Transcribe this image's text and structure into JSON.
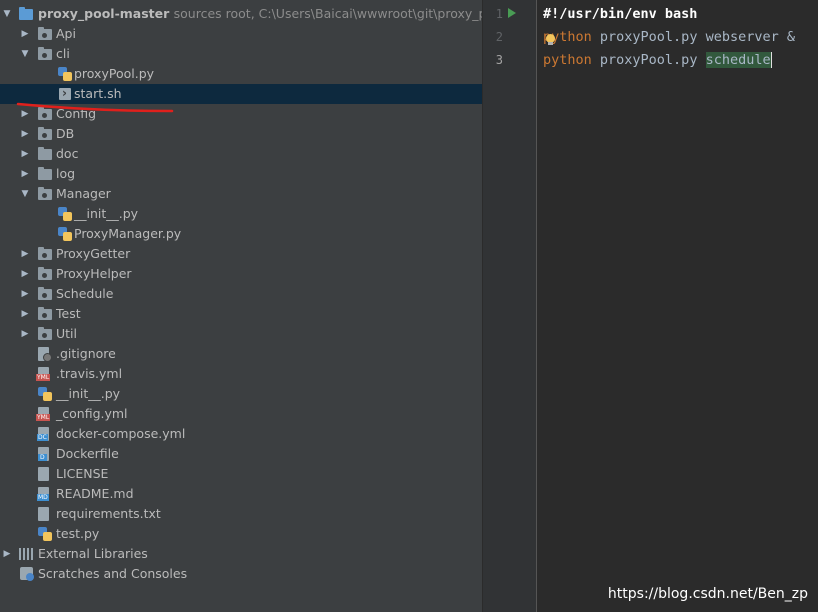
{
  "project_tree": {
    "root": {
      "name": "proxy_pool-master",
      "hint": "sources root,  C:\\Users\\Baicai\\wwwroot\\git\\proxy_pool-"
    },
    "items": [
      {
        "label": "Api",
        "type": "package",
        "expanded": false
      },
      {
        "label": "cli",
        "type": "package",
        "expanded": true
      },
      {
        "label": "proxyPool.py",
        "type": "python"
      },
      {
        "label": "start.sh",
        "type": "shell",
        "selected": true
      },
      {
        "label": "Config",
        "type": "package",
        "expanded": false
      },
      {
        "label": "DB",
        "type": "package",
        "expanded": false
      },
      {
        "label": "doc",
        "type": "folder",
        "expanded": false
      },
      {
        "label": "log",
        "type": "folder",
        "expanded": false
      },
      {
        "label": "Manager",
        "type": "package",
        "expanded": true
      },
      {
        "label": "__init__.py",
        "type": "python"
      },
      {
        "label": "ProxyManager.py",
        "type": "python"
      },
      {
        "label": "ProxyGetter",
        "type": "package",
        "expanded": false
      },
      {
        "label": "ProxyHelper",
        "type": "package",
        "expanded": false
      },
      {
        "label": "Schedule",
        "type": "package",
        "expanded": false
      },
      {
        "label": "Test",
        "type": "package",
        "expanded": false
      },
      {
        "label": "Util",
        "type": "package",
        "expanded": false
      },
      {
        "label": ".gitignore",
        "type": "gitignore"
      },
      {
        "label": ".travis.yml",
        "type": "yml"
      },
      {
        "label": "__init__.py",
        "type": "python"
      },
      {
        "label": "_config.yml",
        "type": "yml"
      },
      {
        "label": "docker-compose.yml",
        "type": "docker-compose"
      },
      {
        "label": "Dockerfile",
        "type": "dockerfile"
      },
      {
        "label": "LICENSE",
        "type": "text"
      },
      {
        "label": "README.md",
        "type": "markdown"
      },
      {
        "label": "requirements.txt",
        "type": "text"
      },
      {
        "label": "test.py",
        "type": "python"
      }
    ],
    "external": {
      "label": "External Libraries"
    },
    "scratches": {
      "label": "Scratches and Consoles"
    }
  },
  "editor": {
    "line_numbers": [
      "1",
      "2",
      "3"
    ],
    "lines": [
      {
        "shebang": "#!/usr/bin/env bash"
      },
      {
        "keyword": "python",
        "rest": " proxyPool.py webserver &"
      },
      {
        "keyword": "python",
        "rest": " proxyPool.py ",
        "highlighted": "schedule"
      }
    ]
  },
  "watermark": "https://blog.csdn.net/Ben_zp",
  "colors": {
    "annotation_underline": "#e0201c",
    "selection": "#0d293e"
  }
}
